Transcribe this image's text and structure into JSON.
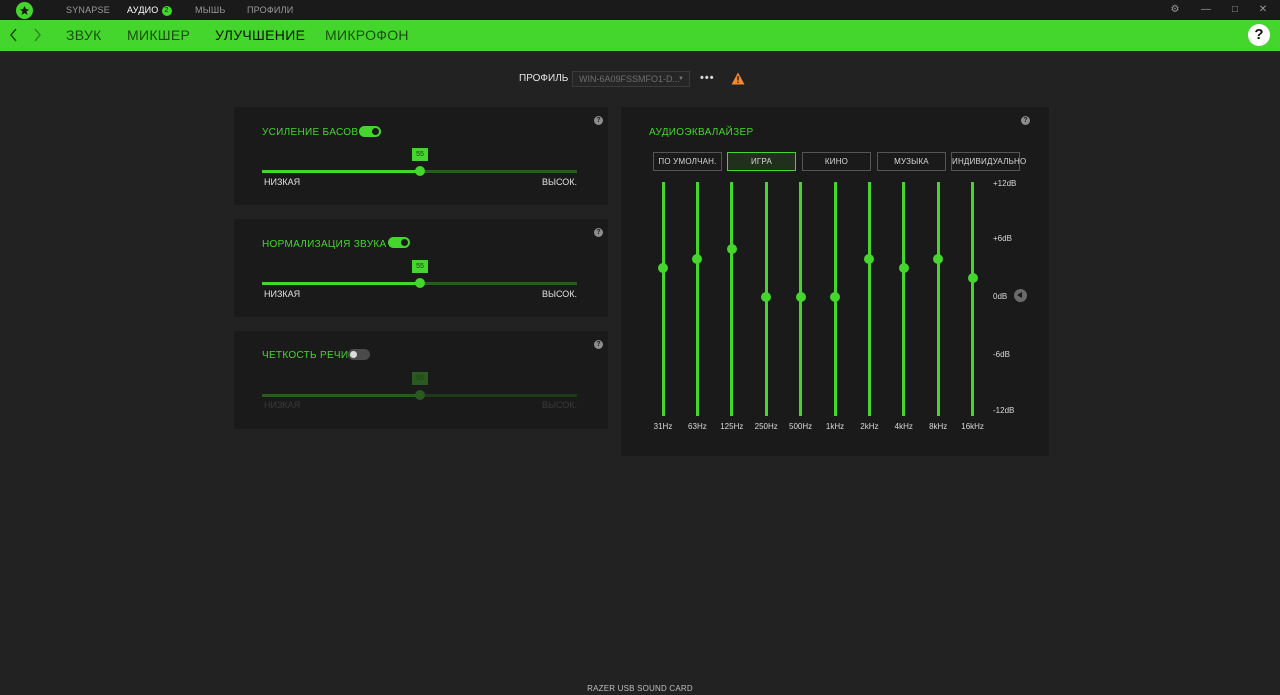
{
  "titlebar": {
    "nav": [
      {
        "label": "SYNAPSE"
      },
      {
        "label": "АУДИО",
        "badge": "2"
      },
      {
        "label": "МЫШЬ"
      },
      {
        "label": "ПРОФИЛИ"
      }
    ],
    "settings_icon": "⚙",
    "minimize_icon": "—",
    "maximize_icon": "□",
    "close_icon": "✕"
  },
  "subnav": {
    "tabs": [
      {
        "label": "ЗВУК"
      },
      {
        "label": "МИКШЕР"
      },
      {
        "label": "УЛУЧШЕНИЕ"
      },
      {
        "label": "МИКРОФОН"
      }
    ],
    "active_tab": "УЛУЧШЕНИЕ",
    "help_icon": "?"
  },
  "profile": {
    "label": "ПРОФИЛЬ",
    "value": "WIN-6A09FSSMFO1-D..."
  },
  "enhancements": [
    {
      "title": "УСИЛЕНИЕ БАСОВ",
      "enabled": true,
      "value": "55",
      "min_label": "НИЗКАЯ",
      "max_label": "ВЫСОК."
    },
    {
      "title": "НОРМАЛИЗАЦИЯ ЗВУКА",
      "enabled": true,
      "value": "55",
      "min_label": "НИЗКАЯ",
      "max_label": "ВЫСОК."
    },
    {
      "title": "ЧЕТКОСТЬ РЕЧИ",
      "enabled": false,
      "value": "55",
      "min_label": "НИЗКАЯ",
      "max_label": "ВЫСОК."
    }
  ],
  "equalizer": {
    "title": "АУДИОЭКВАЛАЙЗЕР",
    "presets": [
      {
        "label": "ПО УМОЛЧАН."
      },
      {
        "label": "ИГРА"
      },
      {
        "label": "КИНО"
      },
      {
        "label": "МУЗЫКА"
      },
      {
        "label": "ИНДИВИДУАЛЬНО"
      }
    ],
    "active_preset": "ИГРА",
    "db_labels": [
      "+12dB",
      "+6dB",
      "0dB",
      "-6dB",
      "-12dB"
    ],
    "bands": [
      {
        "freq": "31Hz",
        "gain_db": 3
      },
      {
        "freq": "63Hz",
        "gain_db": 4
      },
      {
        "freq": "125Hz",
        "gain_db": 5
      },
      {
        "freq": "250Hz",
        "gain_db": 0
      },
      {
        "freq": "500Hz",
        "gain_db": 0
      },
      {
        "freq": "1kHz",
        "gain_db": 0
      },
      {
        "freq": "2kHz",
        "gain_db": 4
      },
      {
        "freq": "4kHz",
        "gain_db": 3
      },
      {
        "freq": "8kHz",
        "gain_db": 4
      },
      {
        "freq": "16kHz",
        "gain_db": 2
      }
    ],
    "range_db": [
      -12,
      12
    ]
  },
  "footer": {
    "device": "RAZER USB SOUND CARD"
  },
  "colors": {
    "accent": "#44d62c",
    "card": "#1a1a1a",
    "background": "#222222",
    "warning": "#f5892a"
  }
}
